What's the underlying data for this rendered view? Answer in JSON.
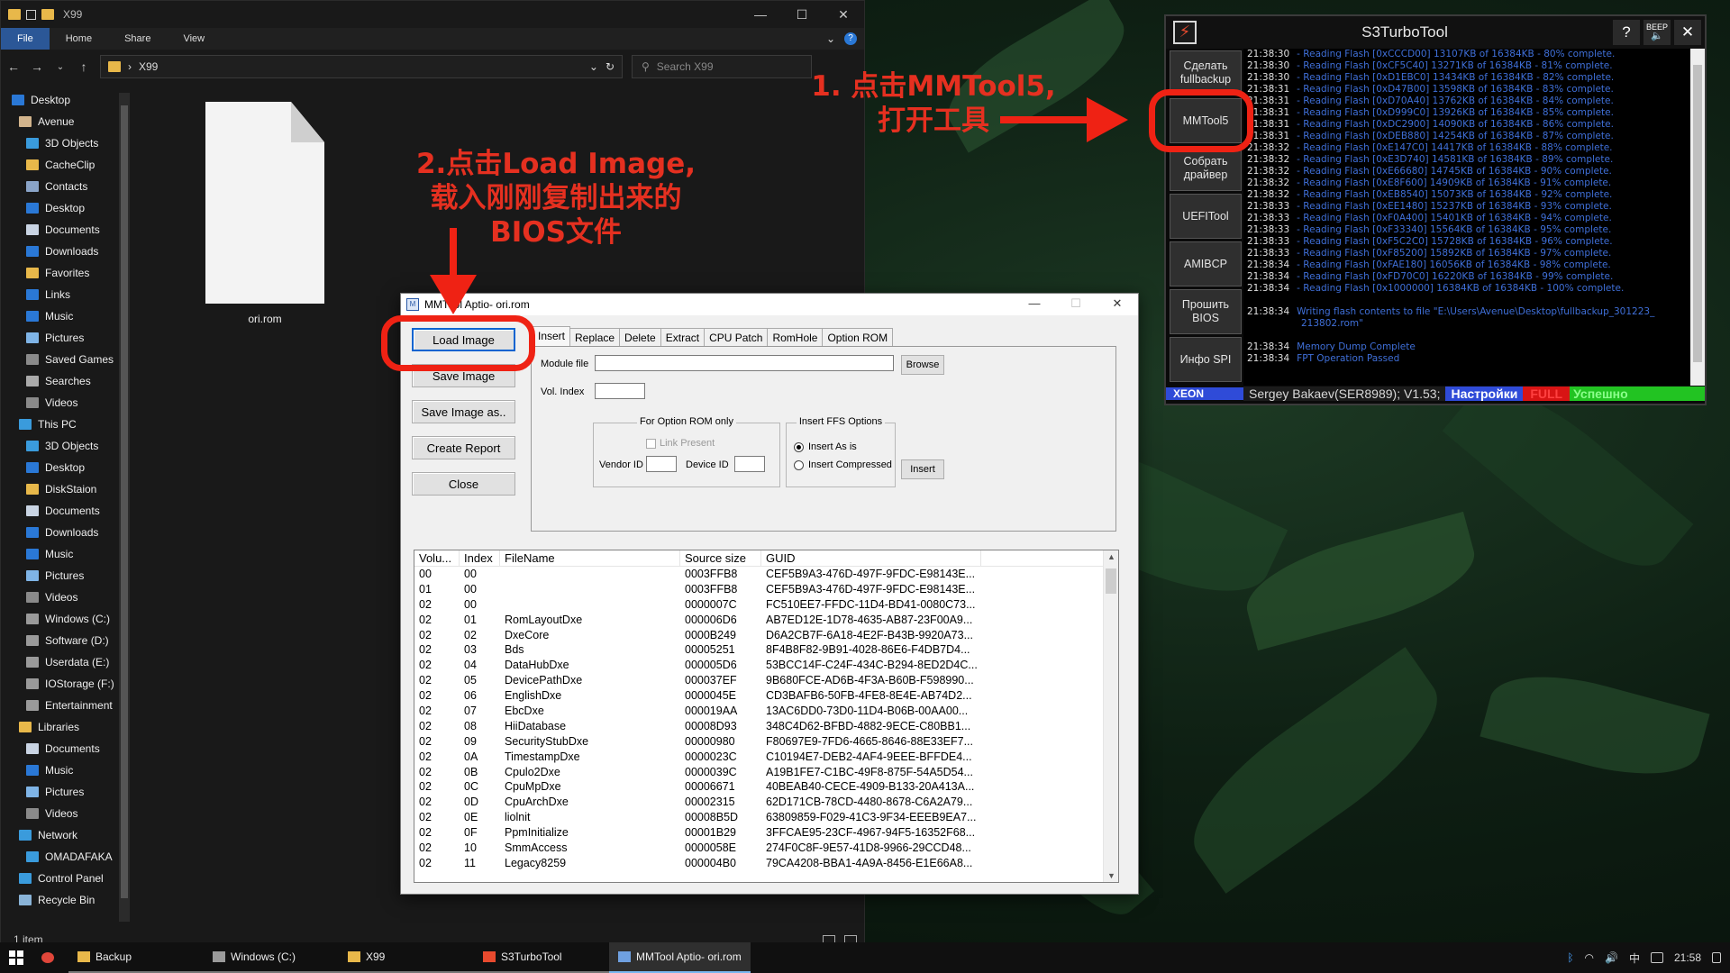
{
  "explorer": {
    "title": "X99",
    "ribbon_tabs": [
      "File",
      "Home",
      "Share",
      "View"
    ],
    "address": "X99",
    "search_placeholder": "Search X99",
    "nav_items": [
      {
        "label": "Desktop",
        "icon": "desktop-icon",
        "color": "#2a78d6",
        "indent": 0
      },
      {
        "label": "Avenue",
        "icon": "user-icon",
        "color": "#d2b48c",
        "indent": 1
      },
      {
        "label": "3D Objects",
        "icon": "cube-icon",
        "color": "#3a9bdc",
        "indent": 2
      },
      {
        "label": "CacheClip",
        "icon": "folder-icon",
        "color": "#e8b84a",
        "indent": 2
      },
      {
        "label": "Contacts",
        "icon": "contacts-icon",
        "color": "#8aa4c8",
        "indent": 2
      },
      {
        "label": "Desktop",
        "icon": "desktop-icon",
        "color": "#2a78d6",
        "indent": 2
      },
      {
        "label": "Documents",
        "icon": "documents-icon",
        "color": "#c9d4e3",
        "indent": 2
      },
      {
        "label": "Downloads",
        "icon": "download-icon",
        "color": "#2a78d6",
        "indent": 2
      },
      {
        "label": "Favorites",
        "icon": "star-icon",
        "color": "#e8b84a",
        "indent": 2
      },
      {
        "label": "Links",
        "icon": "link-icon",
        "color": "#2a78d6",
        "indent": 2
      },
      {
        "label": "Music",
        "icon": "music-icon",
        "color": "#2a78d6",
        "indent": 2
      },
      {
        "label": "Pictures",
        "icon": "pictures-icon",
        "color": "#7fb4e6",
        "indent": 2
      },
      {
        "label": "Saved Games",
        "icon": "games-icon",
        "color": "#8a8a8a",
        "indent": 2
      },
      {
        "label": "Searches",
        "icon": "search-icon",
        "color": "#aaaaaa",
        "indent": 2
      },
      {
        "label": "Videos",
        "icon": "videos-icon",
        "color": "#8a8a8a",
        "indent": 2
      },
      {
        "label": "This PC",
        "icon": "pc-icon",
        "color": "#3a9bdc",
        "indent": 1
      },
      {
        "label": "3D Objects",
        "icon": "cube-icon",
        "color": "#3a9bdc",
        "indent": 2
      },
      {
        "label": "Desktop",
        "icon": "desktop-icon",
        "color": "#2a78d6",
        "indent": 2
      },
      {
        "label": "DiskStaion",
        "icon": "folder-icon",
        "color": "#e8b84a",
        "indent": 2
      },
      {
        "label": "Documents",
        "icon": "documents-icon",
        "color": "#c9d4e3",
        "indent": 2
      },
      {
        "label": "Downloads",
        "icon": "download-icon",
        "color": "#2a78d6",
        "indent": 2
      },
      {
        "label": "Music",
        "icon": "music-icon",
        "color": "#2a78d6",
        "indent": 2
      },
      {
        "label": "Pictures",
        "icon": "pictures-icon",
        "color": "#7fb4e6",
        "indent": 2
      },
      {
        "label": "Videos",
        "icon": "videos-icon",
        "color": "#8a8a8a",
        "indent": 2
      },
      {
        "label": "Windows (C:)",
        "icon": "drive-icon",
        "color": "#9a9a9a",
        "indent": 2
      },
      {
        "label": "Software (D:)",
        "icon": "drive-icon",
        "color": "#9a9a9a",
        "indent": 2
      },
      {
        "label": "Userdata (E:)",
        "icon": "drive-icon",
        "color": "#9a9a9a",
        "indent": 2
      },
      {
        "label": "IOStorage (F:)",
        "icon": "drive-icon",
        "color": "#9a9a9a",
        "indent": 2
      },
      {
        "label": "Entertainment",
        "icon": "drive-icon",
        "color": "#9a9a9a",
        "indent": 2
      },
      {
        "label": "Libraries",
        "icon": "libraries-icon",
        "color": "#e8b84a",
        "indent": 1
      },
      {
        "label": "Documents",
        "icon": "documents-icon",
        "color": "#c9d4e3",
        "indent": 2
      },
      {
        "label": "Music",
        "icon": "music-icon",
        "color": "#2a78d6",
        "indent": 2
      },
      {
        "label": "Pictures",
        "icon": "pictures-icon",
        "color": "#7fb4e6",
        "indent": 2
      },
      {
        "label": "Videos",
        "icon": "videos-icon",
        "color": "#8a8a8a",
        "indent": 2
      },
      {
        "label": "Network",
        "icon": "network-icon",
        "color": "#3a9bdc",
        "indent": 1
      },
      {
        "label": "OMADAFAKA",
        "icon": "pc-icon",
        "color": "#3a9bdc",
        "indent": 2
      },
      {
        "label": "Control Panel",
        "icon": "control-panel-icon",
        "color": "#3a9bdc",
        "indent": 1
      },
      {
        "label": "Recycle Bin",
        "icon": "recycle-bin-icon",
        "color": "#8ab4d8",
        "indent": 1
      }
    ],
    "file_name": "ori.rom",
    "status": "1 item"
  },
  "mmtool": {
    "title": "MMTool Aptio- ori.rom",
    "buttons": [
      "Load Image",
      "Save Image",
      "Save Image as..",
      "Create Report",
      "Close"
    ],
    "tabs": [
      "Insert",
      "Replace",
      "Delete",
      "Extract",
      "CPU Patch",
      "RomHole",
      "Option ROM"
    ],
    "module_file_label": "Module file",
    "browse_label": "Browse",
    "vol_index_label": "Vol. Index",
    "option_rom_group": "For Option ROM only",
    "link_present": "Link Present",
    "vendor_id": "Vendor ID",
    "device_id": "Device ID",
    "ffs_group": "Insert FFS Options",
    "insert_as_is": "Insert As is",
    "insert_compressed": "Insert Compressed",
    "insert_button": "Insert",
    "columns": [
      "Volu...",
      "Index",
      "FileName",
      "Source size",
      "GUID"
    ],
    "rows": [
      [
        "00",
        "00",
        "",
        "0003FFB8",
        "CEF5B9A3-476D-497F-9FDC-E98143E..."
      ],
      [
        "01",
        "00",
        "",
        "0003FFB8",
        "CEF5B9A3-476D-497F-9FDC-E98143E..."
      ],
      [
        "02",
        "00",
        "",
        "0000007C",
        "FC510EE7-FFDC-11D4-BD41-0080C73..."
      ],
      [
        "02",
        "01",
        "RomLayoutDxe",
        "000006D6",
        "AB7ED12E-1D78-4635-AB87-23F00A9..."
      ],
      [
        "02",
        "02",
        "DxeCore",
        "0000B249",
        "D6A2CB7F-6A18-4E2F-B43B-9920A73..."
      ],
      [
        "02",
        "03",
        "Bds",
        "00005251",
        "8F4B8F82-9B91-4028-86E6-F4DB7D4..."
      ],
      [
        "02",
        "04",
        "DataHubDxe",
        "000005D6",
        "53BCC14F-C24F-434C-B294-8ED2D4C..."
      ],
      [
        "02",
        "05",
        "DevicePathDxe",
        "000037EF",
        "9B680FCE-AD6B-4F3A-B60B-F598990..."
      ],
      [
        "02",
        "06",
        "EnglishDxe",
        "0000045E",
        "CD3BAFB6-50FB-4FE8-8E4E-AB74D2..."
      ],
      [
        "02",
        "07",
        "EbcDxe",
        "000019AA",
        "13AC6DD0-73D0-11D4-B06B-00AA00..."
      ],
      [
        "02",
        "08",
        "HiiDatabase",
        "00008D93",
        "348C4D62-BFBD-4882-9ECE-C80BB1..."
      ],
      [
        "02",
        "09",
        "SecurityStubDxe",
        "00000980",
        "F80697E9-7FD6-4665-8646-88E33EF7..."
      ],
      [
        "02",
        "0A",
        "TimestampDxe",
        "0000023C",
        "C10194E7-DEB2-4AF4-9EEE-BFFDE4..."
      ],
      [
        "02",
        "0B",
        "Cpulo2Dxe",
        "0000039C",
        "A19B1FE7-C1BC-49F8-875F-54A5D54..."
      ],
      [
        "02",
        "0C",
        "CpuMpDxe",
        "00006671",
        "40BEAB40-CECE-4909-B133-20A413A..."
      ],
      [
        "02",
        "0D",
        "CpuArchDxe",
        "00002315",
        "62D171CB-78CD-4480-8678-C6A2A79..."
      ],
      [
        "02",
        "0E",
        "liolnit",
        "00008B5D",
        "63809859-F029-41C3-9F34-EEEB9EA7..."
      ],
      [
        "02",
        "0F",
        "PpmInitialize",
        "00001B29",
        "3FFCAE95-23CF-4967-94F5-16352F68..."
      ],
      [
        "02",
        "10",
        "SmmAccess",
        "0000058E",
        "274F0C8F-9E57-41D8-9966-29CCD48..."
      ],
      [
        "02",
        "11",
        "Legacy8259",
        "000004B0",
        "79CA4208-BBA1-4A9A-8456-E1E66A8..."
      ]
    ]
  },
  "s3": {
    "title": "S3TurboTool",
    "beep_label": "BEEP",
    "side_buttons": [
      "Сделать fullbackup",
      "MMTool5",
      "Собрать драйвер",
      "UEFITool",
      "AMIBCP",
      "Прошить BIOS",
      "Инфо SPI"
    ],
    "log": [
      {
        "t": "21:38:30",
        "m": "- Reading Flash [0xCCCD00] 13107KB of 16384KB - 80% complete."
      },
      {
        "t": "21:38:30",
        "m": "- Reading Flash [0xCF5C40] 13271KB of 16384KB - 81% complete."
      },
      {
        "t": "21:38:30",
        "m": "- Reading Flash [0xD1EBC0] 13434KB of 16384KB - 82% complete."
      },
      {
        "t": "21:38:31",
        "m": "- Reading Flash [0xD47B00] 13598KB of 16384KB - 83% complete."
      },
      {
        "t": "21:38:31",
        "m": "- Reading Flash [0xD70A40] 13762KB of 16384KB - 84% complete."
      },
      {
        "t": "21:38:31",
        "m": "- Reading Flash [0xD999C0] 13926KB of 16384KB - 85% complete."
      },
      {
        "t": "21:38:31",
        "m": "- Reading Flash [0xDC2900] 14090KB of 16384KB - 86% complete."
      },
      {
        "t": "21:38:31",
        "m": "- Reading Flash [0xDEB880] 14254KB of 16384KB - 87% complete."
      },
      {
        "t": "21:38:32",
        "m": "- Reading Flash [0xE147C0] 14417KB of 16384KB - 88% complete."
      },
      {
        "t": "21:38:32",
        "m": "- Reading Flash [0xE3D740] 14581KB of 16384KB - 89% complete."
      },
      {
        "t": "21:38:32",
        "m": "- Reading Flash [0xE66680] 14745KB of 16384KB - 90% complete."
      },
      {
        "t": "21:38:32",
        "m": "- Reading Flash [0xE8F600] 14909KB of 16384KB - 91% complete."
      },
      {
        "t": "21:38:32",
        "m": "- Reading Flash [0xEB8540] 15073KB of 16384KB - 92% complete."
      },
      {
        "t": "21:38:33",
        "m": "- Reading Flash [0xEE1480] 15237KB of 16384KB - 93% complete."
      },
      {
        "t": "21:38:33",
        "m": "- Reading Flash [0xF0A400] 15401KB of 16384KB - 94% complete."
      },
      {
        "t": "21:38:33",
        "m": "- Reading Flash [0xF33340] 15564KB of 16384KB - 95% complete."
      },
      {
        "t": "21:38:33",
        "m": "- Reading Flash [0xF5C2C0] 15728KB of 16384KB - 96% complete."
      },
      {
        "t": "21:38:33",
        "m": "- Reading Flash [0xF85200] 15892KB of 16384KB - 97% complete."
      },
      {
        "t": "21:38:34",
        "m": "- Reading Flash [0xFAE180] 16056KB of 16384KB - 98% complete."
      },
      {
        "t": "21:38:34",
        "m": "- Reading Flash [0xFD70C0] 16220KB of 16384KB - 99% complete."
      },
      {
        "t": "21:38:34",
        "m": "- Reading Flash [0x1000000] 16384KB of 16384KB - 100% complete."
      },
      {
        "t": "",
        "m": ""
      },
      {
        "t": "21:38:34",
        "m": "Writing flash contents to file \"E:\\Users\\Avenue\\Desktop\\fullbackup_301223_"
      },
      {
        "t": "",
        "m": "213802.rom\""
      },
      {
        "t": "",
        "m": ""
      },
      {
        "t": "21:38:34",
        "m": "Memory Dump Complete"
      },
      {
        "t": "21:38:34",
        "m": "FPT Operation Passed"
      }
    ],
    "status_xeon": "XEON",
    "status_author": "Sergey Bakaev(SER8989); V1.53;",
    "status_settings": "Настройки",
    "status_full": "FULL",
    "status_ok": "Успешно"
  },
  "annotations": {
    "step1": [
      "1. 点击MMTool5,",
      "打开工具"
    ],
    "step2": [
      "2.点击Load Image,",
      "载入刚刚复制出来的",
      "BIOS文件"
    ],
    "color": "#ef2214"
  },
  "taskbar": {
    "apps": [
      {
        "label": "",
        "icon": "chrome-icon",
        "active": false,
        "plain": true
      },
      {
        "label": "Backup",
        "icon": "folder-icon",
        "active": false,
        "plain": false
      },
      {
        "label": "Windows (C:)",
        "icon": "drive-icon",
        "active": false,
        "plain": false
      },
      {
        "label": "X99",
        "icon": "folder-icon",
        "active": false,
        "plain": false
      },
      {
        "label": "S3TurboTool",
        "icon": "s3turbotool-icon",
        "active": false,
        "plain": false
      },
      {
        "label": "MMTool Aptio- ori.rom",
        "icon": "mmtool-icon",
        "active": true,
        "plain": false
      }
    ],
    "ime": "中",
    "clock": "21:58"
  }
}
